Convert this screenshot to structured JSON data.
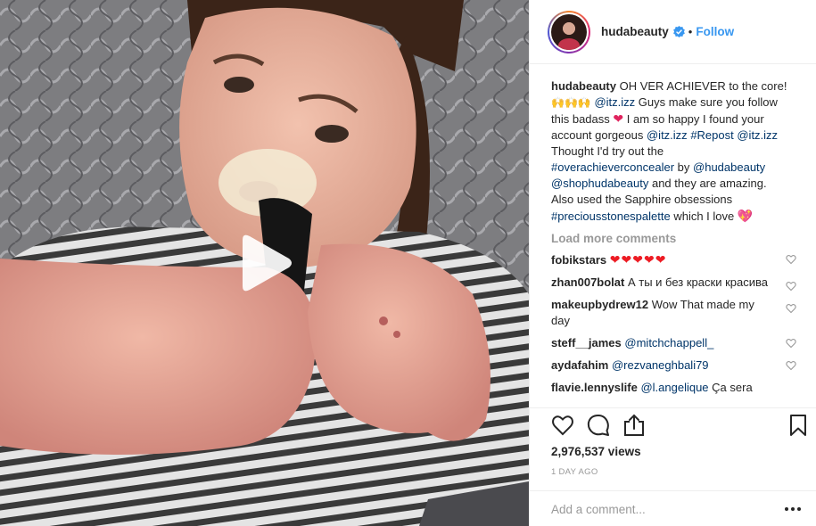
{
  "video": {
    "play_icon": "play-icon"
  },
  "header": {
    "username": "hudabeauty",
    "verified_icon": "verified-badge-icon",
    "separator": "•",
    "follow_label": "Follow"
  },
  "caption": {
    "username": "hudabeauty",
    "t1": "OH VER ACHIEVER to the core!",
    "emojis": "🙌🙌🙌",
    "m1": "@itz.izz",
    "t2": "Guys make sure you follow this badass",
    "heart": "❤",
    "t3": "I am so happy I found your account gorgeous",
    "m2": "@itz.izz",
    "h1": "#Repost",
    "m3": "@itz.izz",
    "t4": "Thought I'd try out the",
    "h2": "#overachieverconcealer",
    "t5": "by",
    "m4": "@hudabeauty",
    "m5": "@shophudabeauty",
    "t6": "and they are amazing. Also used the Sapphire obsessions",
    "h3": "#preciousstonespalette",
    "t7": "which I love",
    "heart2": "💖"
  },
  "load_more_label": "Load more comments",
  "comments": [
    {
      "user": "fobikstars",
      "text": "❤❤❤❤❤",
      "mention": ""
    },
    {
      "user": "zhan007bolat",
      "text": "А ты и без краски красива",
      "mention": ""
    },
    {
      "user": "makeupbydrew12",
      "text": "Wow That made my day",
      "mention": ""
    },
    {
      "user": "steff__james",
      "text": "",
      "mention": "@mitchchappell_"
    },
    {
      "user": "aydafahim",
      "text": "",
      "mention": "@rezvaneghbali79"
    },
    {
      "user": "flavie.lennyslife",
      "text": "Ça sera",
      "mention": "@l.angelique"
    }
  ],
  "actions": {
    "like_icon": "heart-icon",
    "comment_icon": "comment-icon",
    "share_icon": "share-icon",
    "save_icon": "bookmark-icon"
  },
  "views": "2,976,537 views",
  "time": "1 DAY AGO",
  "add_comment": {
    "placeholder": "Add a comment...",
    "more_icon": "more-options-icon"
  }
}
